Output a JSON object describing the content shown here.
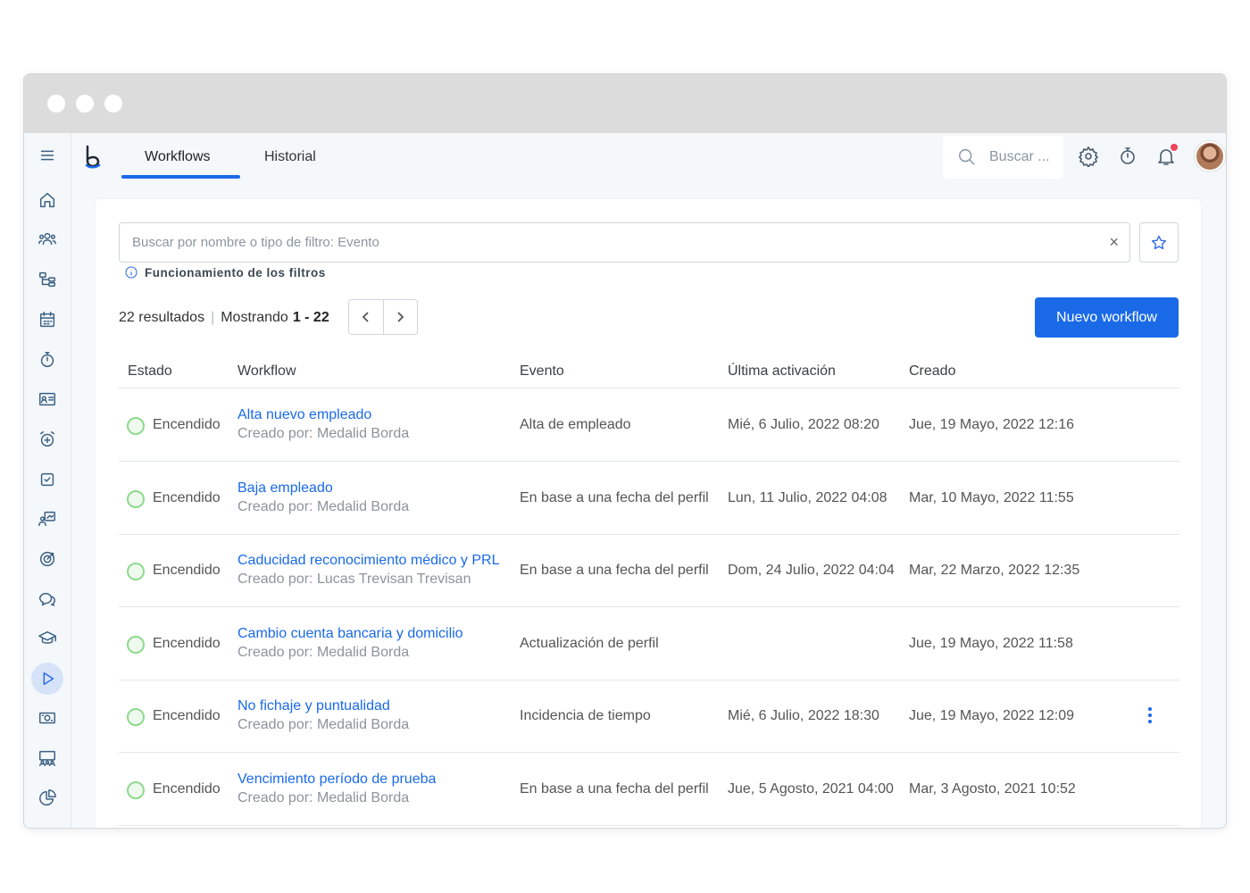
{
  "topbar": {
    "tabs": [
      {
        "label": "Workflows",
        "active": true
      },
      {
        "label": "Historial",
        "active": false
      }
    ],
    "search_placeholder": "Buscar ..."
  },
  "sidebar": {
    "icons": [
      "menu-icon",
      "home-icon",
      "people-icon",
      "org-chart-icon",
      "calendar-icon",
      "stopwatch-icon",
      "id-card-icon",
      "alarm-icon",
      "checkbox-icon",
      "presentation-icon",
      "target-icon",
      "chat-icon",
      "graduation-icon",
      "play-icon",
      "money-icon",
      "team-icon",
      "pie-chart-icon"
    ],
    "active": "play-icon"
  },
  "filter": {
    "placeholder": "Buscar por nombre o tipo de filtro: Evento",
    "clear": "×",
    "help_label": "Funcionamiento de los filtros"
  },
  "results": {
    "count_label": "22 resultados",
    "showing_label": "Mostrando",
    "range": "1 - 22"
  },
  "actions": {
    "new_workflow": "Nuevo workflow"
  },
  "table": {
    "headers": {
      "estado": "Estado",
      "workflow": "Workflow",
      "evento": "Evento",
      "ultima": "Última activación",
      "creado": "Creado"
    },
    "rows": [
      {
        "status": "Encendido",
        "name": "Alta nuevo empleado",
        "by": "Creado por: Medalid Borda",
        "evento": "Alta de empleado",
        "ultima": "Mié, 6 Julio, 2022 08:20",
        "creado": "Jue, 19 Mayo, 2022 12:16"
      },
      {
        "status": "Encendido",
        "name": "Baja empleado",
        "by": "Creado por: Medalid Borda",
        "evento": "En base a una fecha del perfil",
        "ultima": "Lun, 11 Julio, 2022 04:08",
        "creado": "Mar, 10 Mayo, 2022 11:55"
      },
      {
        "status": "Encendido",
        "name": "Caducidad reconocimiento médico y PRL",
        "by": "Creado por: Lucas Trevisan Trevisan",
        "evento": "En base a una fecha del perfil",
        "ultima": "Dom, 24 Julio, 2022 04:04",
        "creado": "Mar, 22 Marzo, 2022 12:35"
      },
      {
        "status": "Encendido",
        "name": "Cambio cuenta bancaria y domicilio",
        "by": "Creado por: Medalid Borda",
        "evento": "Actualización de perfil",
        "ultima": "",
        "creado": "Jue, 19 Mayo, 2022 11:58"
      },
      {
        "status": "Encendido",
        "name": "No fichaje y puntualidad",
        "by": "Creado por: Medalid Borda",
        "evento": "Incidencia de tiempo",
        "ultima": "Mié, 6 Julio, 2022 18:30",
        "creado": "Jue, 19 Mayo, 2022 12:09"
      },
      {
        "status": "Encendido",
        "name": "Vencimiento período de prueba",
        "by": "Creado por: Medalid Borda",
        "evento": "En base a una fecha del perfil",
        "ultima": "Jue, 5 Agosto, 2021 04:00",
        "creado": "Mar, 3 Agosto, 2021 10:52"
      }
    ]
  },
  "colors": {
    "accent": "#1a6ae8",
    "status_on": "#8fd98f",
    "notification": "#f0455a"
  }
}
